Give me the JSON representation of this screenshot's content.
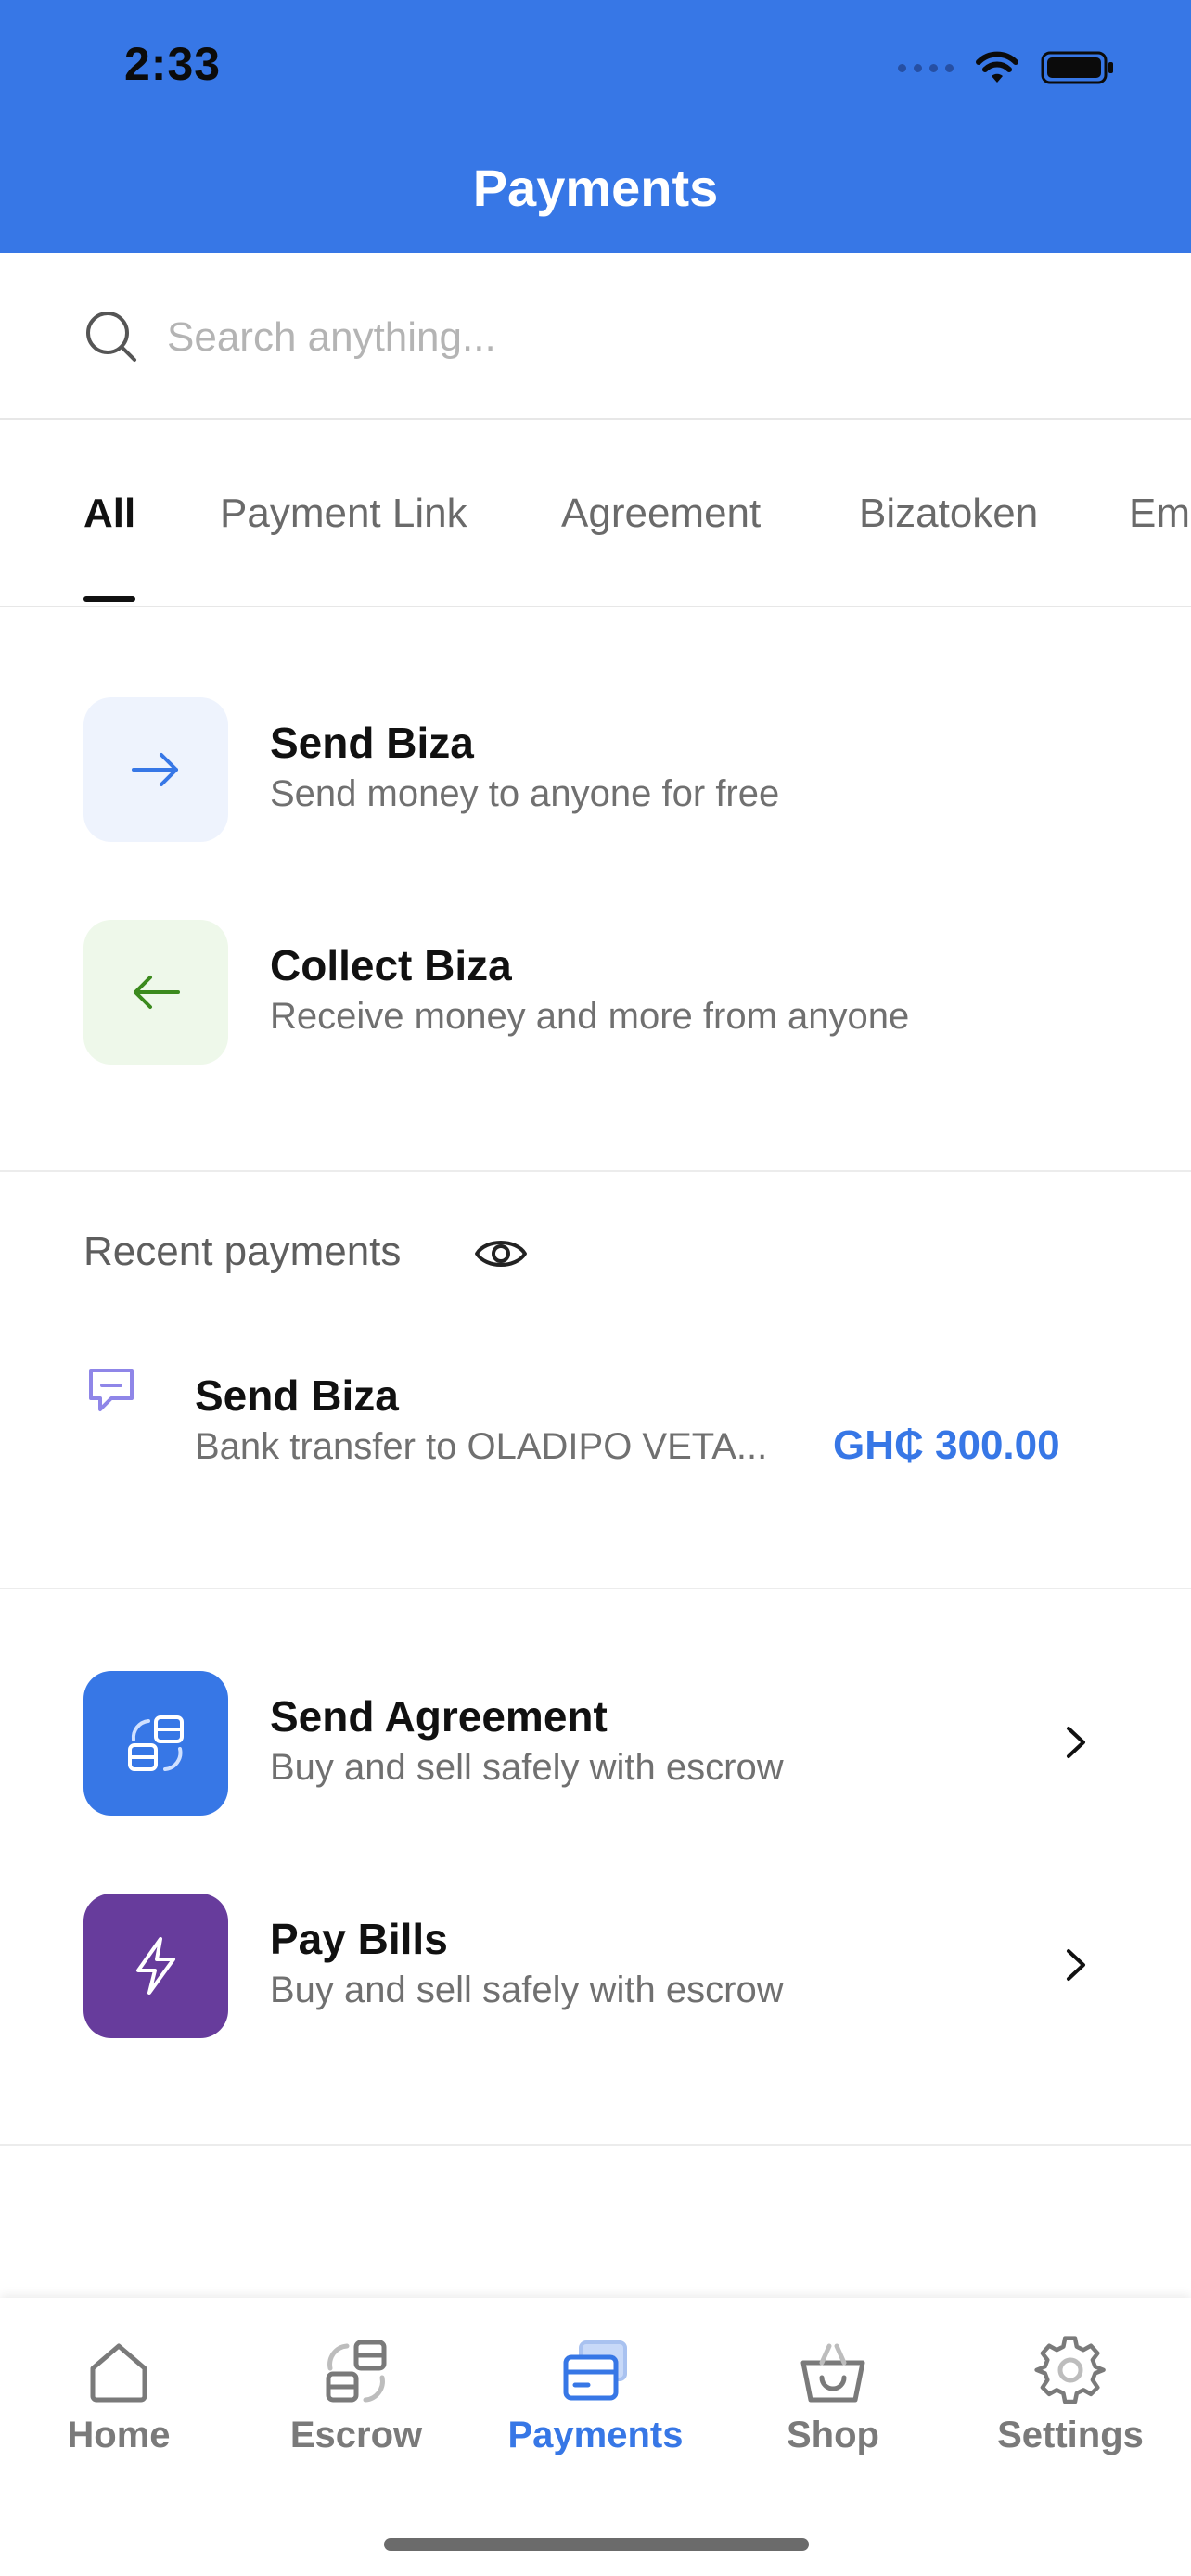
{
  "status_bar": {
    "time": "2:33"
  },
  "header": {
    "title": "Payments"
  },
  "search": {
    "placeholder": "Search anything..."
  },
  "tabs": [
    "All",
    "Payment Link",
    "Agreement",
    "Bizatoken",
    "Em"
  ],
  "actions": {
    "send_biza": {
      "title": "Send Biza",
      "subtitle": "Send money to anyone for free"
    },
    "collect_biza": {
      "title": "Collect Biza",
      "subtitle": "Receive money and more from anyone"
    }
  },
  "recent": {
    "heading": "Recent payments",
    "items": [
      {
        "title": "Send Biza",
        "subtitle": "Bank transfer to OLADIPO VETA...",
        "amount": "GH₵ 300.00"
      }
    ]
  },
  "services": {
    "send_agreement": {
      "title": "Send Agreement",
      "subtitle": "Buy and sell safely with escrow"
    },
    "pay_bills": {
      "title": "Pay Bills",
      "subtitle": "Buy and sell safely with escrow"
    }
  },
  "bottom_nav": [
    {
      "label": "Home",
      "icon": "home-icon"
    },
    {
      "label": "Escrow",
      "icon": "escrow-icon"
    },
    {
      "label": "Payments",
      "icon": "payments-icon"
    },
    {
      "label": "Shop",
      "icon": "shop-icon"
    },
    {
      "label": "Settings",
      "icon": "settings-icon"
    }
  ],
  "colors": {
    "accent": "#3777e6",
    "collect_green": "#3b8a1e",
    "pay_bills_purple": "#673c9c",
    "muted_text": "#707070"
  }
}
